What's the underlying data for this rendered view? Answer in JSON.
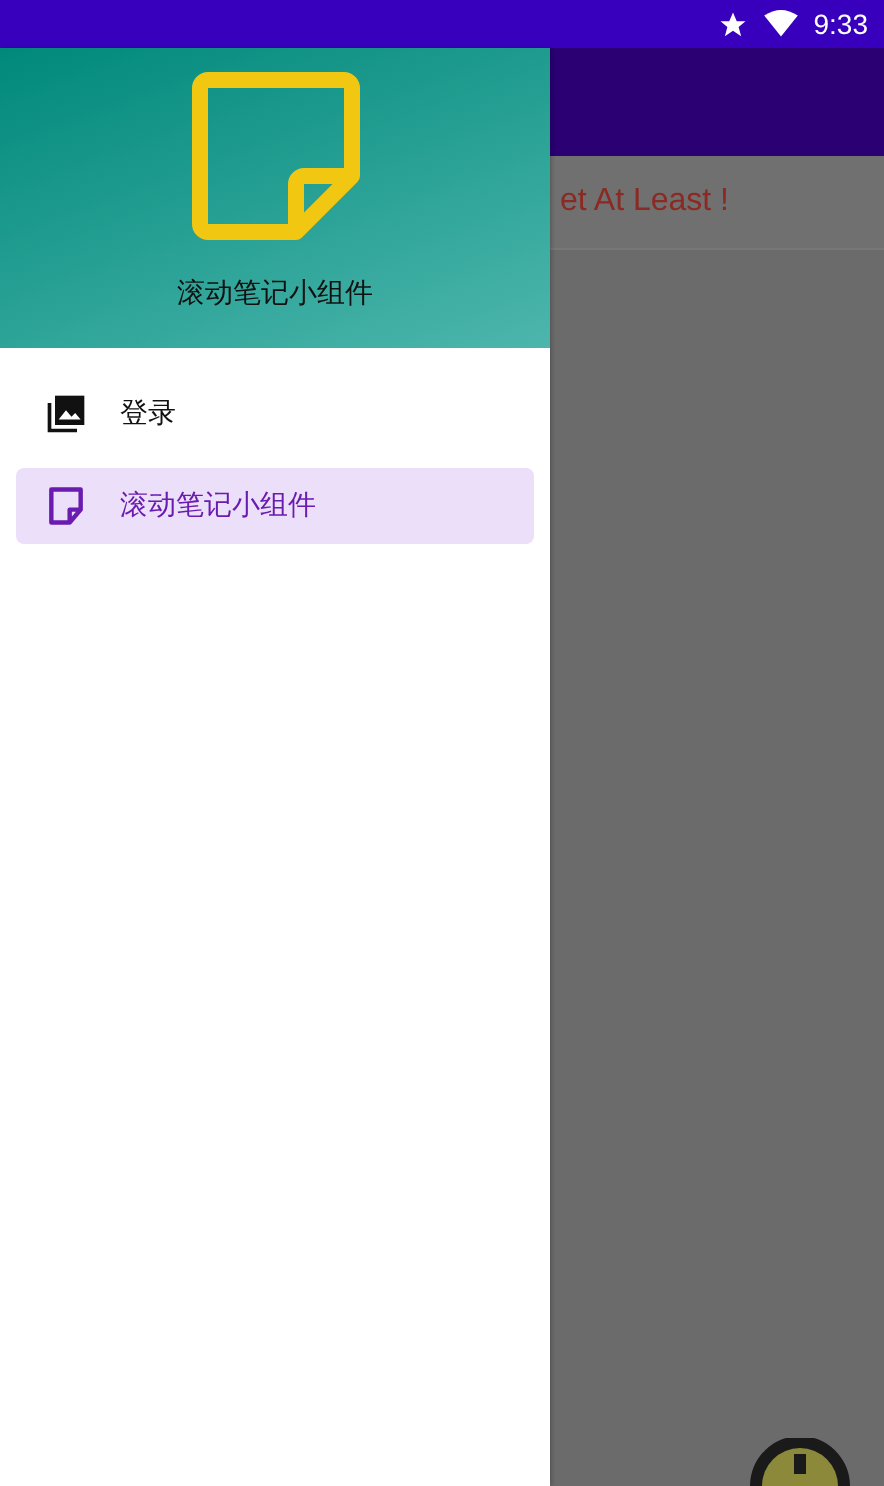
{
  "status_bar": {
    "time": "9:33"
  },
  "background_app": {
    "message": "et At Least !"
  },
  "drawer": {
    "header_title": "滚动笔记小组件",
    "items": [
      {
        "label": "登录",
        "kind": "photos",
        "selected": false
      },
      {
        "label": "滚动笔记小组件",
        "kind": "note",
        "selected": true
      }
    ]
  }
}
